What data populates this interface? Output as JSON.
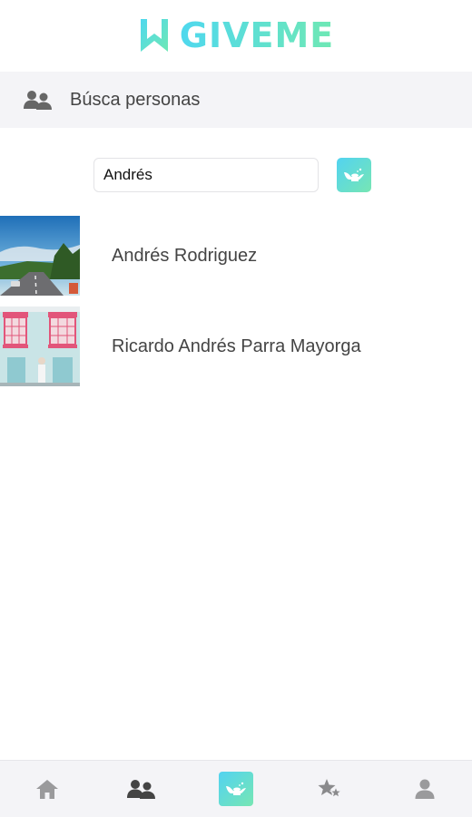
{
  "app": {
    "brand": "GIVEME",
    "brand_colors": [
      "#4fd8ee",
      "#6fe8b4"
    ]
  },
  "section": {
    "title": "Búsca personas",
    "icon": "people-icon"
  },
  "search": {
    "value": "Andrés",
    "button_icon": "magic-lamp-icon"
  },
  "results": [
    {
      "name": "Andrés Rodriguez",
      "photo": "road-landscape-photo"
    },
    {
      "name": "Ricardo Andrés Parra Mayorga",
      "photo": "pink-windows-house-photo"
    }
  ],
  "tabbar": {
    "items": [
      {
        "icon": "home-icon",
        "active": false
      },
      {
        "icon": "people-icon",
        "active": true
      },
      {
        "icon": "magic-lamp-icon",
        "active": false
      },
      {
        "icon": "stars-icon",
        "active": false
      },
      {
        "icon": "user-icon",
        "active": false
      }
    ]
  }
}
